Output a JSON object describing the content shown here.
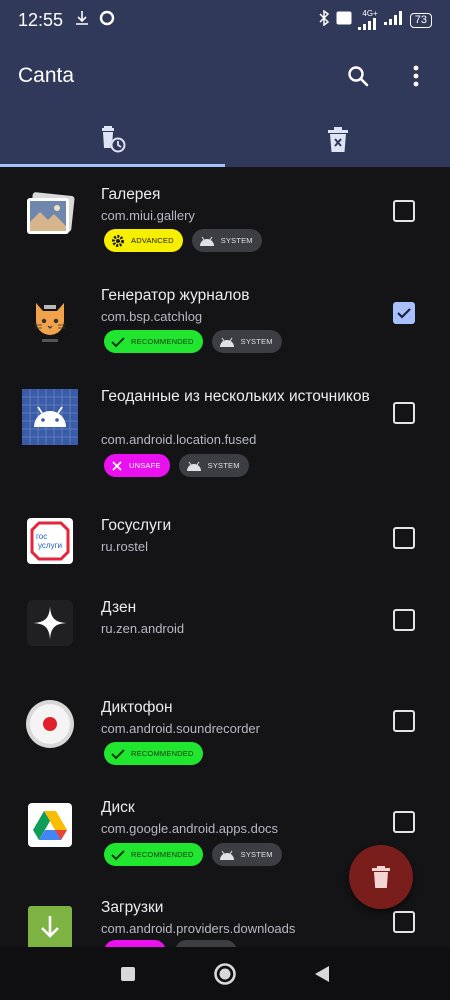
{
  "status_bar": {
    "time": "12:55",
    "battery": "73",
    "network": "4G+",
    "icons": [
      "download-icon",
      "circle-icon",
      "bluetooth-icon",
      "volte-icon",
      "signal-icon",
      "signal-icon",
      "battery-icon"
    ]
  },
  "app_bar": {
    "title": "Canta",
    "actions": [
      "search-icon",
      "more-vert-icon"
    ]
  },
  "tabs": [
    {
      "icon": "trash-clock-icon",
      "selected": true
    },
    {
      "icon": "trash-x-icon",
      "selected": false
    }
  ],
  "apps": [
    {
      "name": "Галерея",
      "package": "com.miui.gallery",
      "icon": "gallery-icon",
      "badges": [
        {
          "type": "advanced",
          "label": "ADVANCED"
        },
        {
          "type": "system",
          "label": "SYSTEM"
        }
      ],
      "checked": false
    },
    {
      "name": "Генератор журналов",
      "package": "com.bsp.catchlog",
      "icon": "cat-icon",
      "badges": [
        {
          "type": "recommended",
          "label": "RECOMMENDED"
        },
        {
          "type": "system",
          "label": "SYSTEM"
        }
      ],
      "checked": true
    },
    {
      "name": "Геоданные из нескольких источников",
      "package": "com.android.location.fused",
      "icon": "android-icon",
      "badges": [
        {
          "type": "unsafe",
          "label": "UNSAFE"
        },
        {
          "type": "system",
          "label": "SYSTEM"
        }
      ],
      "checked": false
    },
    {
      "name": "Госуслуги",
      "package": "ru.rostel",
      "icon": "gosuslugi-icon",
      "icon_text": [
        "гос",
        "услуги"
      ],
      "badges": [],
      "checked": false
    },
    {
      "name": "Дзен",
      "package": "ru.zen.android",
      "icon": "zen-star-icon",
      "badges": [],
      "checked": false
    },
    {
      "name": "Диктофон",
      "package": "com.android.soundrecorder",
      "icon": "recorder-icon",
      "badges": [
        {
          "type": "recommended",
          "label": "RECOMMENDED"
        }
      ],
      "checked": false
    },
    {
      "name": "Диск",
      "package": "com.google.android.apps.docs",
      "icon": "drive-icon",
      "badges": [
        {
          "type": "recommended",
          "label": "RECOMMENDED"
        },
        {
          "type": "system",
          "label": "SYSTEM"
        }
      ],
      "checked": false
    },
    {
      "name": "Загрузки",
      "package": "com.android.providers.downloads",
      "icon": "download-arrow-icon",
      "badges": [
        {
          "type": "unsafe",
          "label": ""
        },
        {
          "type": "system",
          "label": ""
        }
      ],
      "checked": false
    }
  ],
  "fab": {
    "icon": "delete-icon"
  },
  "nav_bar": {
    "buttons": [
      "recents-square-icon",
      "home-circle-icon",
      "back-triangle-icon"
    ]
  },
  "colors": {
    "app_bar": "#31395a",
    "background": "#141417",
    "accent": "#a9c0ff",
    "advanced": "#f6ef00",
    "recommended": "#20e62f",
    "unsafe": "#eb10f0",
    "system": "#3d3d44",
    "fab": "#7a1e1b"
  }
}
